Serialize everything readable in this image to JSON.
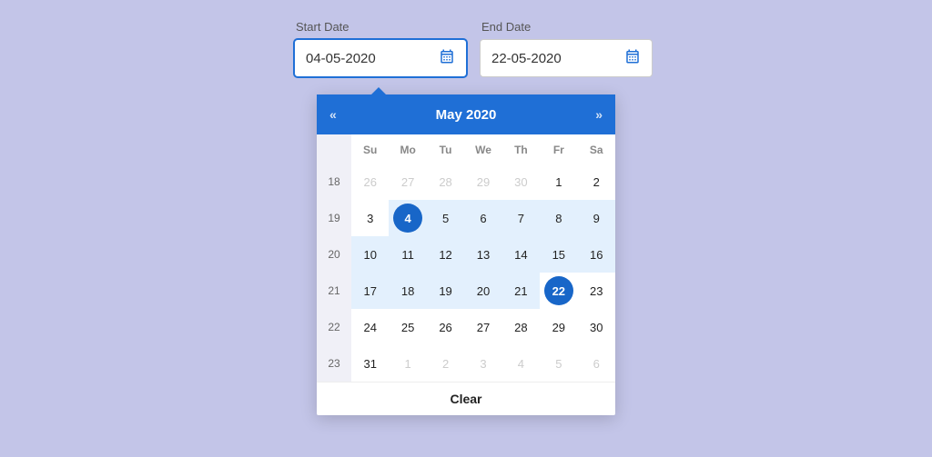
{
  "inputs": {
    "start_label": "Start Date",
    "end_label": "End Date",
    "start_value": "04-05-2020",
    "end_value": "22-05-2020"
  },
  "calendar": {
    "title": "May 2020",
    "prev_glyph": "«",
    "next_glyph": "»",
    "clear_label": "Clear",
    "dow": [
      "Su",
      "Mo",
      "Tu",
      "We",
      "Th",
      "Fr",
      "Sa"
    ],
    "week_header": "",
    "weeks": [
      {
        "wk": "18",
        "days": [
          {
            "n": "26",
            "muted": true
          },
          {
            "n": "27",
            "muted": true
          },
          {
            "n": "28",
            "muted": true
          },
          {
            "n": "29",
            "muted": true
          },
          {
            "n": "30",
            "muted": true
          },
          {
            "n": "1"
          },
          {
            "n": "2"
          }
        ]
      },
      {
        "wk": "19",
        "days": [
          {
            "n": "3"
          },
          {
            "n": "4",
            "sel": true,
            "range": true
          },
          {
            "n": "5",
            "range": true
          },
          {
            "n": "6",
            "range": true
          },
          {
            "n": "7",
            "range": true
          },
          {
            "n": "8",
            "range": true
          },
          {
            "n": "9",
            "range": true
          }
        ]
      },
      {
        "wk": "20",
        "days": [
          {
            "n": "10",
            "range": true
          },
          {
            "n": "11",
            "range": true
          },
          {
            "n": "12",
            "range": true
          },
          {
            "n": "13",
            "range": true
          },
          {
            "n": "14",
            "range": true
          },
          {
            "n": "15",
            "range": true
          },
          {
            "n": "16",
            "range": true
          }
        ]
      },
      {
        "wk": "21",
        "days": [
          {
            "n": "17",
            "range": true
          },
          {
            "n": "18",
            "range": true
          },
          {
            "n": "19",
            "range": true
          },
          {
            "n": "20",
            "range": true
          },
          {
            "n": "21",
            "range": true
          },
          {
            "n": "22",
            "sel": true
          },
          {
            "n": "23"
          }
        ]
      },
      {
        "wk": "22",
        "days": [
          {
            "n": "24"
          },
          {
            "n": "25"
          },
          {
            "n": "26"
          },
          {
            "n": "27"
          },
          {
            "n": "28"
          },
          {
            "n": "29"
          },
          {
            "n": "30"
          }
        ]
      },
      {
        "wk": "23",
        "days": [
          {
            "n": "31"
          },
          {
            "n": "1",
            "muted": true
          },
          {
            "n": "2",
            "muted": true
          },
          {
            "n": "3",
            "muted": true
          },
          {
            "n": "4",
            "muted": true
          },
          {
            "n": "5",
            "muted": true
          },
          {
            "n": "6",
            "muted": true
          }
        ]
      }
    ]
  }
}
